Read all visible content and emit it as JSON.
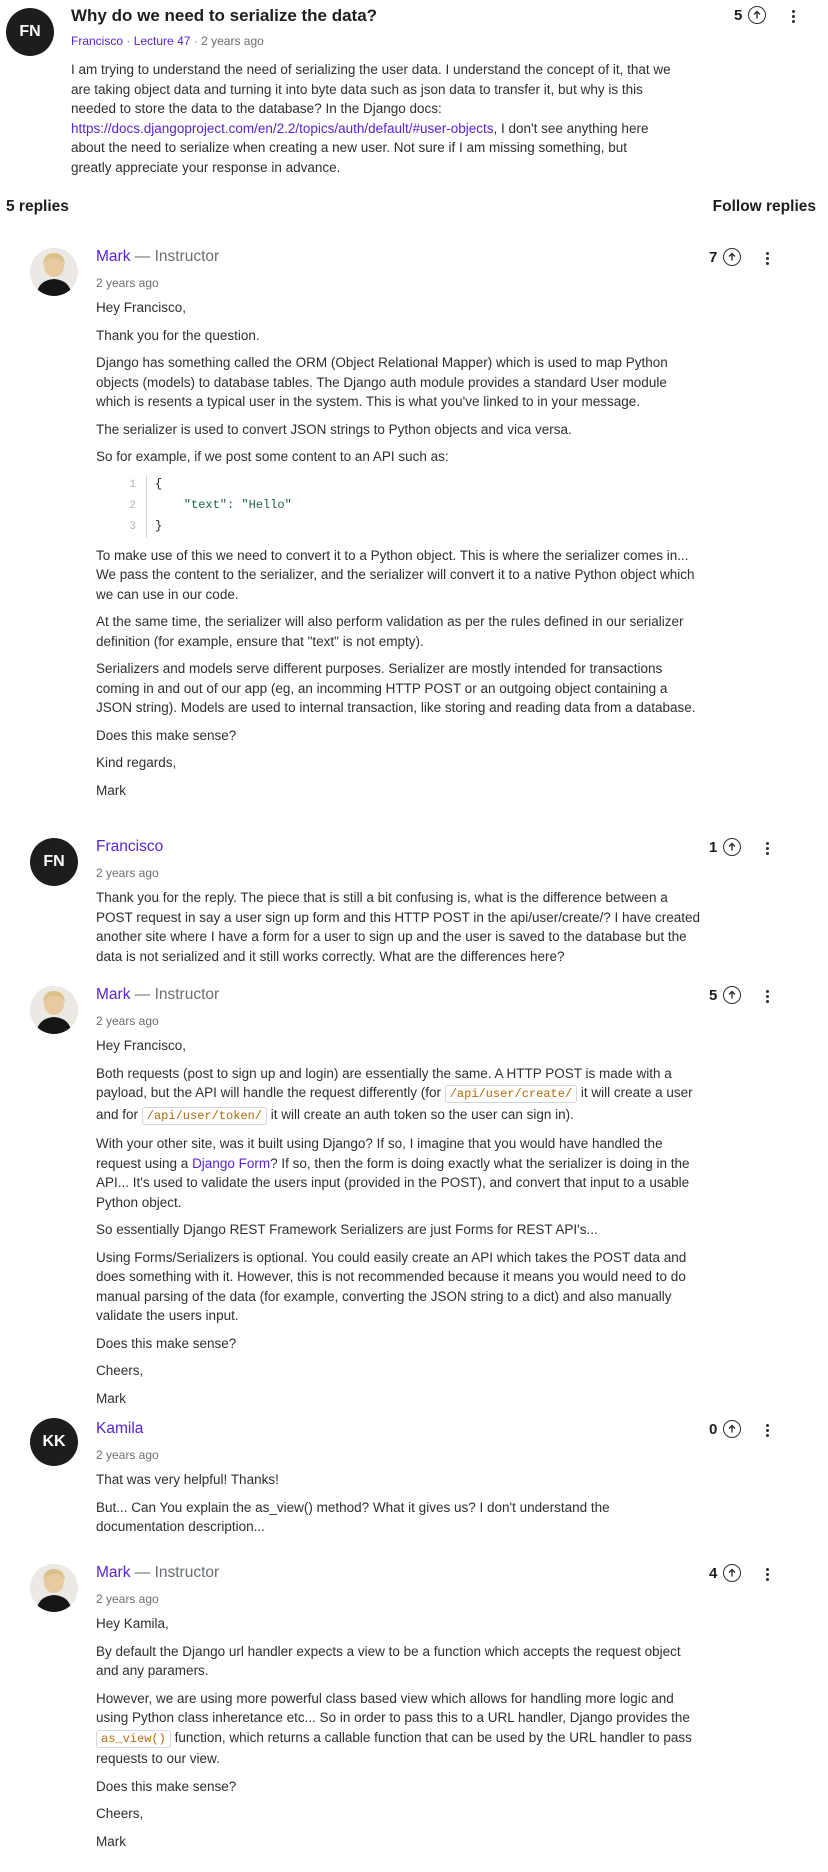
{
  "question": {
    "avatar_initials": "FN",
    "title": "Why do we need to serialize the data?",
    "author": "Francisco",
    "lecture": "Lecture 47",
    "time": "2 years ago",
    "votes": "5",
    "body_1": "I am trying to understand the need of serializing the user data. I understand the concept of it, that we are taking object data and turning it into byte data such as json data to transfer it, but why is this needed to store the data to the database? In the Django docs: ",
    "body_link": "https://docs.djangoproject.com/en/2.2/topics/auth/default/#user-objects",
    "body_2": ", I don't see anything here about the need to serialize when creating a new user. Not sure if I am missing something, but greatly appreciate your response in advance."
  },
  "replies_header": {
    "count_label": "5 replies",
    "follow_label": "Follow replies"
  },
  "replies": [
    {
      "name": "Mark",
      "role": " — Instructor",
      "time": "2 years ago",
      "votes": "7",
      "p1": "Hey Francisco,",
      "p2": "Thank you for the question.",
      "p3": "Django has something called the ORM (Object Relational Mapper) which is used to map Python objects (models) to database tables. The Django auth module provides a standard User module which is resents a typical user in the system. This is what you've linked to in your message.",
      "p4": "The serializer is used to convert JSON strings to Python objects and vica versa.",
      "p5": "So for example, if we post some content to an API such as:",
      "code": [
        {
          "num": "1",
          "text": "{"
        },
        {
          "num": "2",
          "key": "    \"text\": ",
          "val": "\"Hello\""
        },
        {
          "num": "3",
          "text": "}"
        }
      ],
      "p6": "To make use of this we need to convert it to a Python object. This is where the serializer comes in... We pass the content to the serializer, and the serializer will convert it to a native Python object which we can use in our code.",
      "p7": "At the same time, the serializer will also perform validation as per the rules defined in our serializer definition (for example, ensure that \"text\" is not empty).",
      "p8": "Serializers and models serve different purposes. Serializer are mostly intended for transactions coming in and out of our app (eg, an incomming HTTP POST or an outgoing object containing a JSON string). Models are used to internal transaction, like storing and reading data from a database.",
      "p9": "Does this make sense?",
      "p10": "Kind regards,",
      "p11": "Mark"
    },
    {
      "avatar_initials": "FN",
      "name": "Francisco",
      "time": "2 years ago",
      "votes": "1",
      "p1": "Thank you for the reply. The piece that is still a bit confusing is, what is the difference between a POST request in say a user sign up form and this HTTP POST in the api/user/create/? I have created another site where I have a form for a user to sign up and the user is saved to the database but the data is not serialized and it still works correctly. What are the differences here?"
    },
    {
      "name": "Mark",
      "role": " — Instructor",
      "time": "2 years ago",
      "votes": "5",
      "p1": "Hey Francisco,",
      "p2a": "Both requests (post to sign up and login) are essentially the same. A HTTP POST is made with a payload, but the API will handle the request differently (for ",
      "code1": "/api/user/create/",
      "p2b": " it will create a user and for ",
      "code2": "/api/user/token/",
      "p2c": " it will create an auth token so the user can sign in).",
      "p3a": "With your other site, was it built using Django? If so, I imagine that you would have handled the request using a ",
      "p3link": "Django Form",
      "p3b": "? If so, then the form is doing exactly what the serializer is doing in the API... It's used to validate the users input (provided in the POST), and convert that input to a usable Python object.",
      "p4": "So essentially Django REST Framework Serializers are just Forms for REST API's...",
      "p5": "Using Forms/Serializers is optional. You could easily create an API which takes the POST data and does something with it. However, this is not recommended because it means you would need to do manual parsing of the data (for example, converting the JSON string to a dict) and also manually validate the users input.",
      "p6": "Does this make sense?",
      "p7": "Cheers,",
      "p8": "Mark"
    },
    {
      "avatar_initials": "KK",
      "name": "Kamila",
      "time": "2 years ago",
      "votes": "0",
      "p1": "That was very helpful! Thanks!",
      "p2": "But... Can You explain the as_view() method? What it gives us? I don't understand the documentation description..."
    },
    {
      "name": "Mark",
      "role": " — Instructor",
      "time": "2 years ago",
      "votes": "4",
      "p1": "Hey Kamila,",
      "p2": "By default the Django url handler expects a view to be a function which accepts the request object and any paramers.",
      "p3a": "However, we are using more powerful class based view which allows for handling more logic and using Python class inheretance etc... So in order to pass this to a URL handler, Django provides the ",
      "code": "as_view()",
      "p3b": " function, which returns a callable function that can be used by the URL handler to pass requests to our view.",
      "p4": "Does this make sense?",
      "p5": "Cheers,",
      "p6": "Mark"
    }
  ]
}
